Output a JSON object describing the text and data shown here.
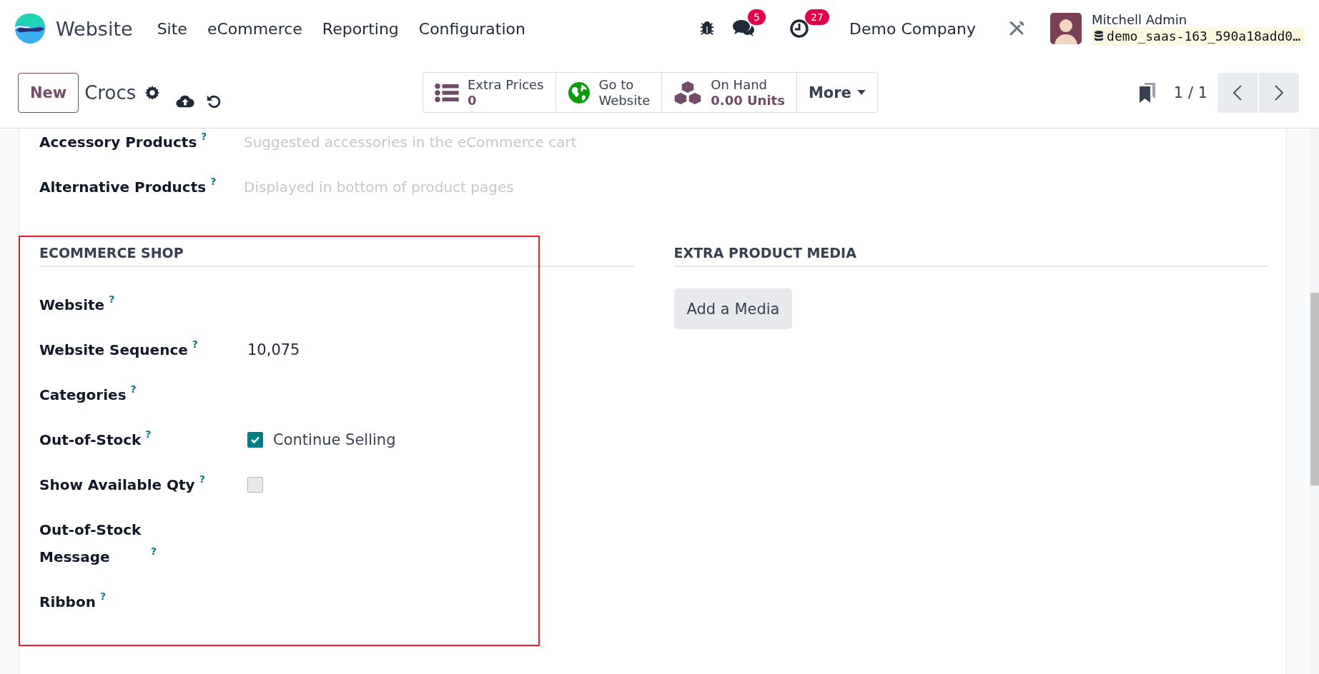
{
  "navbar": {
    "app_name": "Website",
    "menu": [
      "Site",
      "eCommerce",
      "Reporting",
      "Configuration"
    ],
    "chat_count": "5",
    "activity_count": "27",
    "company": "Demo Company",
    "user_name": "Mitchell Admin",
    "database": "demo_saas-163_590a18add0…"
  },
  "control_panel": {
    "new_button": "New",
    "record_name": "Crocs",
    "stat_buttons": [
      {
        "kind": "list",
        "label": "Extra Prices",
        "value": "0"
      },
      {
        "kind": "globe",
        "label": "Go to",
        "value": "Website"
      },
      {
        "kind": "cubes",
        "label": "On Hand",
        "value": "0.00 Units"
      }
    ],
    "more_button": "More",
    "pager": "1 / 1"
  },
  "form": {
    "top_fields": [
      {
        "label": "Accessory Products",
        "help": "?",
        "placeholder": "Suggested accessories in the eCommerce cart"
      },
      {
        "label": "Alternative Products",
        "help": "?",
        "placeholder": "Displayed in bottom of product pages"
      }
    ],
    "ecommerce_shop": {
      "title": "ECOMMERCE SHOP",
      "highlighted": true,
      "fields": [
        {
          "kind": "empty",
          "label": "Website",
          "help": "?"
        },
        {
          "kind": "text",
          "label": "Website Sequence",
          "help": "?",
          "value": "10,075"
        },
        {
          "kind": "empty",
          "label": "Categories",
          "help": "?"
        },
        {
          "kind": "checkbox",
          "label": "Out-of-Stock",
          "help": "?",
          "checked": true,
          "option": "Continue Selling"
        },
        {
          "kind": "checkbox",
          "label": "Show Available Qty",
          "help": "?",
          "checked": false
        },
        {
          "kind": "empty",
          "label": "Out-of-Stock Message",
          "help": "?"
        },
        {
          "kind": "empty",
          "label": "Ribbon",
          "help": "?"
        }
      ]
    },
    "extra_product_media": {
      "title": "EXTRA PRODUCT MEDIA",
      "button": "Add a Media"
    }
  }
}
